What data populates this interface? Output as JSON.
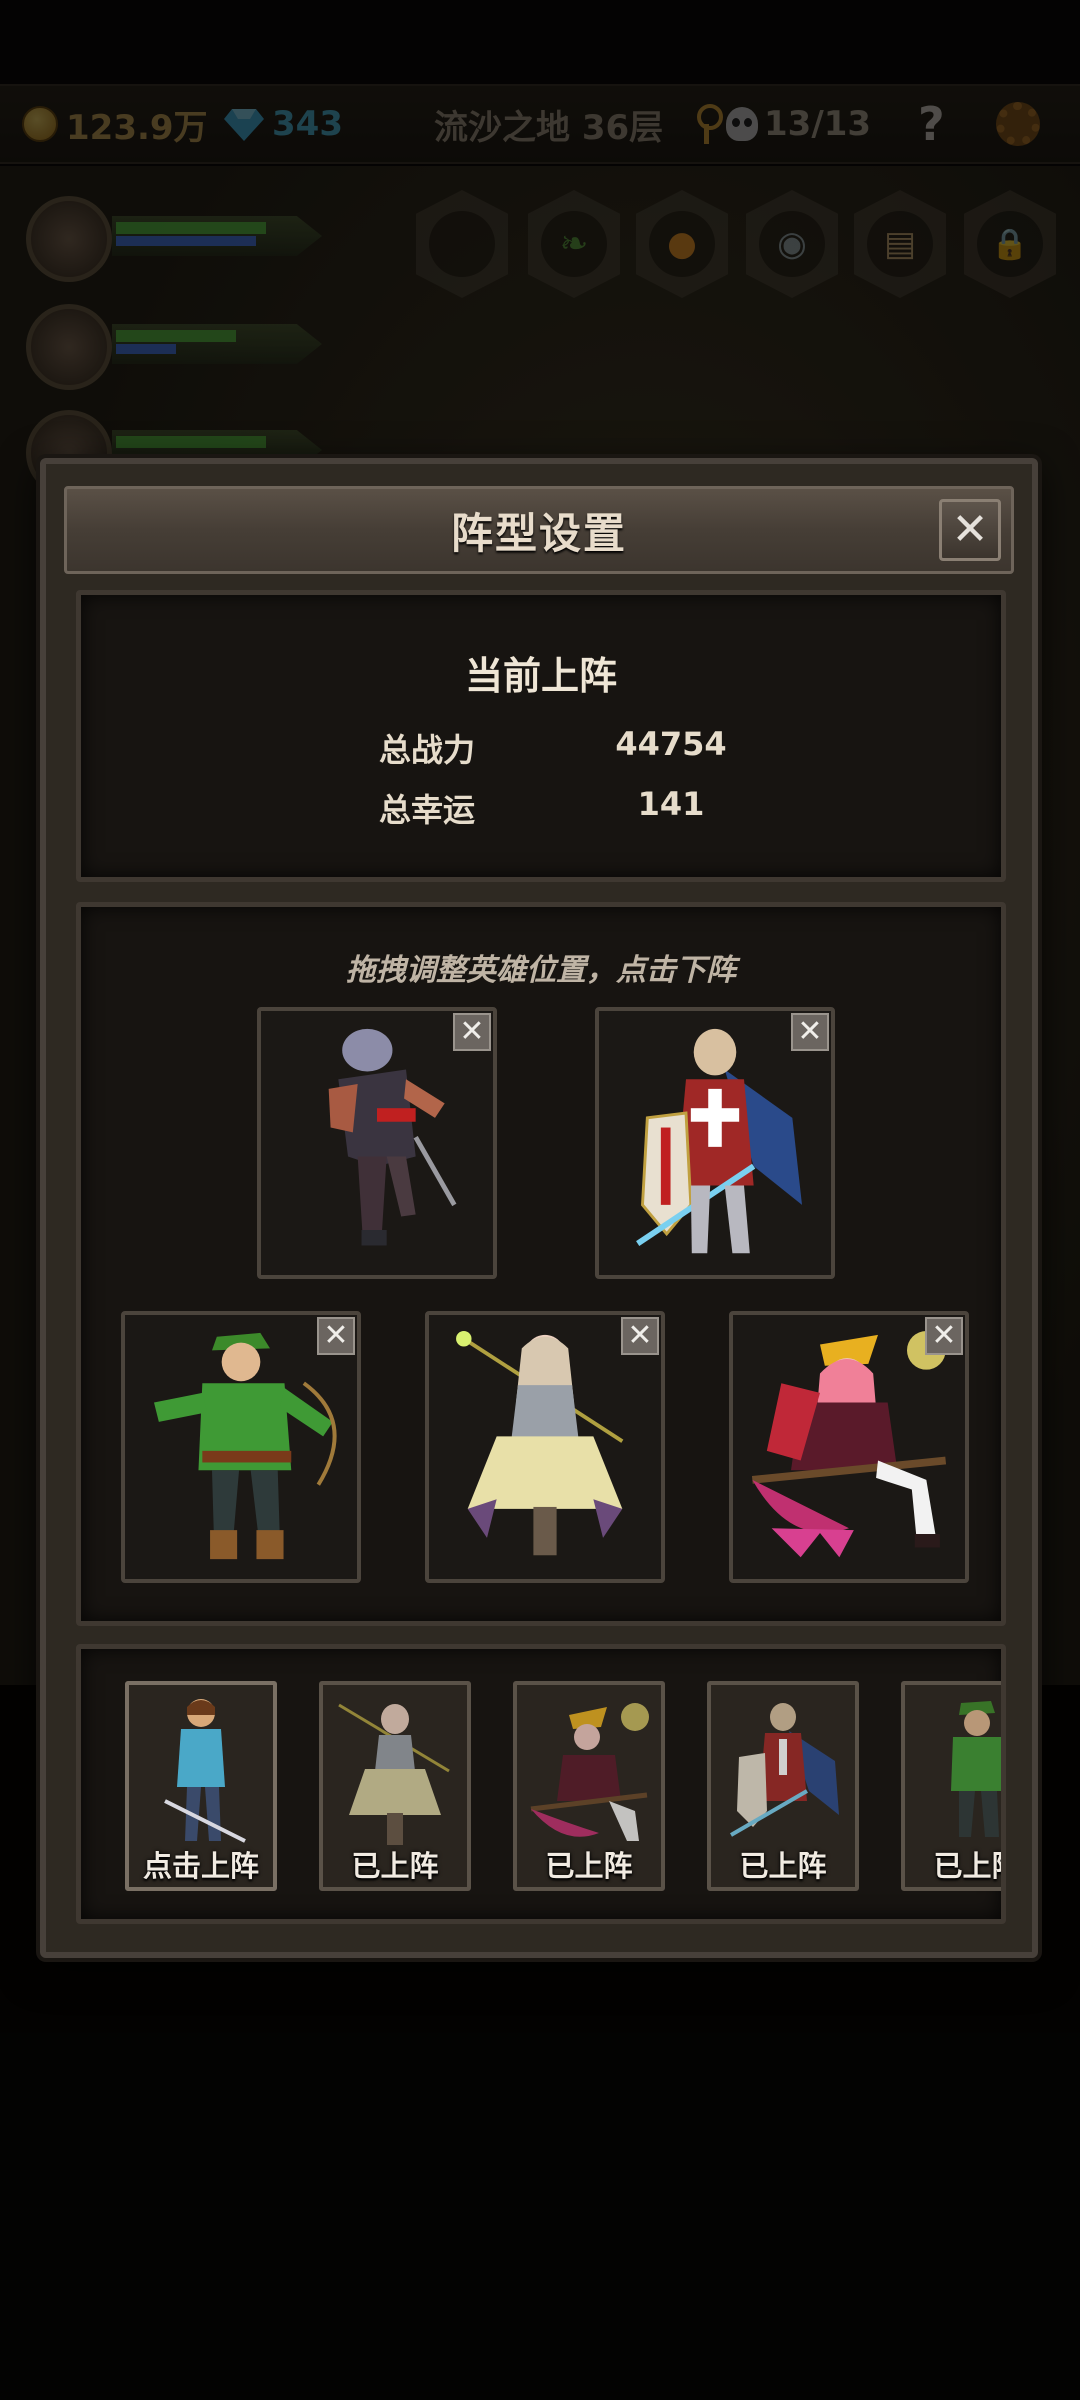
{
  "hud": {
    "gold": "123.9万",
    "gems": "343",
    "location": "流沙之地 36层",
    "kills": "13/13",
    "help": "?",
    "icons": {
      "gold": "coin-icon",
      "gems": "diamond-icon",
      "key": "key-icon",
      "kills": "skull-icon",
      "settings": "gear-icon"
    }
  },
  "modal": {
    "title": "阵型设置",
    "close": "✕",
    "stats": {
      "heading": "当前上阵",
      "power_label": "总战力",
      "power_value": "44754",
      "luck_label": "总幸运",
      "luck_value": "141"
    },
    "hint": "拖拽调整英雄位置，点击下阵",
    "remove": "✕",
    "formation": [
      {
        "hero": "dark-warrior"
      },
      {
        "hero": "crusader-knight"
      },
      {
        "hero": "green-archer"
      },
      {
        "hero": "priestess-mage"
      },
      {
        "hero": "witch-on-broom"
      }
    ],
    "roster": [
      {
        "hero": "blue-swordsman",
        "label": "点击上阵"
      },
      {
        "hero": "priestess-mage",
        "label": "已上阵"
      },
      {
        "hero": "witch-on-broom",
        "label": "已上阵"
      },
      {
        "hero": "crusader-knight",
        "label": "已上阵"
      },
      {
        "hero": "green-archer",
        "label": "已上阵"
      }
    ]
  },
  "colors": {
    "gold": "#c9a35a",
    "gems": "#4fb8d8",
    "panel_border": "#3f3831",
    "modal_bg": "#2e2922"
  }
}
